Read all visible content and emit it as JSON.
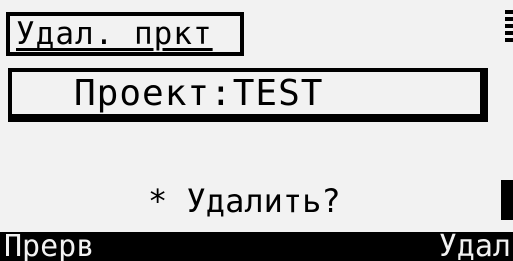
{
  "screen": {
    "title": "Удал. пркт",
    "project_field": "Проект:TEST",
    "prompt": "* Удалить?"
  },
  "softkeys": {
    "left_label": "Прерв",
    "right_label": "Удал"
  },
  "colors": {
    "background": "#f2f2f2",
    "foreground": "#000000"
  }
}
